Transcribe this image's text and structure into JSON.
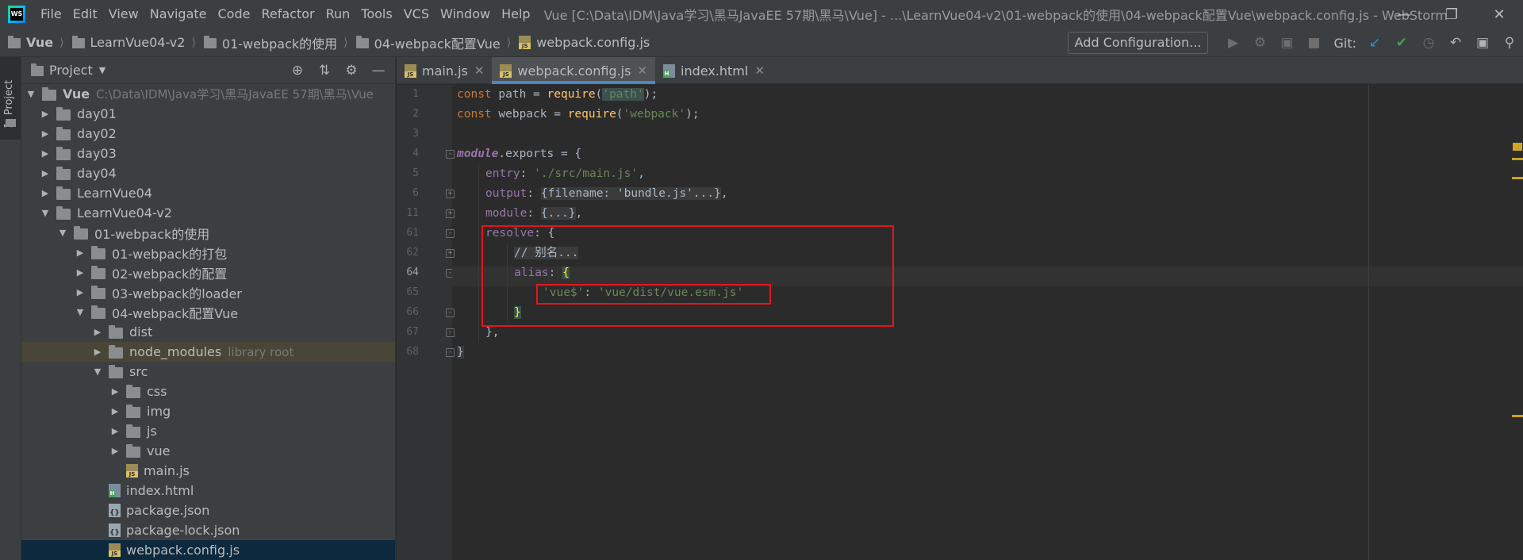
{
  "titlebar": {
    "menu": [
      "File",
      "Edit",
      "View",
      "Navigate",
      "Code",
      "Refactor",
      "Run",
      "Tools",
      "VCS",
      "Window",
      "Help"
    ],
    "window_title": "Vue [C:\\Data\\IDM\\Java学习\\黑马JavaEE 57期\\黑马\\Vue] - ...\\LearnVue04-v2\\01-webpack的使用\\04-webpack配置Vue\\webpack.config.js - WebStorm"
  },
  "navbar": {
    "crumbs": [
      "Vue",
      "LearnVue04-v2",
      "01-webpack的使用",
      "04-webpack配置Vue",
      "webpack.config.js"
    ],
    "add_config": "Add Configuration...",
    "git_label": "Git:"
  },
  "tool_strip": {
    "label": "1: Project"
  },
  "project_panel": {
    "title": "Project",
    "tree": [
      {
        "name": "Vue",
        "path": "C:\\Data\\IDM\\Java学习\\黑马JavaEE 57期\\黑马\\Vue"
      },
      {
        "name": "day01"
      },
      {
        "name": "day02"
      },
      {
        "name": "day03"
      },
      {
        "name": "day04"
      },
      {
        "name": "LearnVue04"
      },
      {
        "name": "LearnVue04-v2"
      },
      {
        "name": "01-webpack的使用"
      },
      {
        "name": "01-webpack的打包"
      },
      {
        "name": "02-webpack的配置"
      },
      {
        "name": "03-webpack的loader"
      },
      {
        "name": "04-webpack配置Vue"
      },
      {
        "name": "dist"
      },
      {
        "name": "node_modules",
        "note": "library root"
      },
      {
        "name": "src"
      },
      {
        "name": "css"
      },
      {
        "name": "img"
      },
      {
        "name": "js"
      },
      {
        "name": "vue"
      },
      {
        "name": "main.js"
      },
      {
        "name": "index.html"
      },
      {
        "name": "package.json"
      },
      {
        "name": "package-lock.json"
      },
      {
        "name": "webpack.config.js"
      }
    ]
  },
  "editor": {
    "tabs": [
      {
        "label": "main.js"
      },
      {
        "label": "webpack.config.js"
      },
      {
        "label": "index.html"
      }
    ],
    "line_numbers": [
      "1",
      "2",
      "3",
      "4",
      "5",
      "6",
      "11",
      "61",
      "62",
      "64",
      "65",
      "66",
      "67",
      "68"
    ],
    "code": {
      "l1": {
        "kw": "const",
        "a": " path = ",
        "fn": "require",
        "b": "(",
        "s": "'path'",
        "c": ");"
      },
      "l2": {
        "kw": "const",
        "a": " webpack = ",
        "fn": "require",
        "b": "(",
        "s": "'webpack'",
        "c": ");"
      },
      "l4": {
        "obj": "module",
        "a": ".exports = {"
      },
      "l5": {
        "p": "entry",
        "a": ": ",
        "s": "'./src/main.js'",
        "c": ","
      },
      "l6": {
        "p": "output",
        "a": ": ",
        "f": "{filename: 'bundle.js'...}",
        "c": ","
      },
      "l11": {
        "p": "module",
        "a": ": ",
        "f": "{...}",
        "c": ","
      },
      "l61": {
        "p": "resolve",
        "a": ": {"
      },
      "l62": {
        "cmt": "// 别名..."
      },
      "l64": {
        "p": "alias",
        "a": ": ",
        "brace": "{"
      },
      "l65": {
        "k": "'vue$'",
        "a": ": ",
        "s": "'vue/dist/vue.esm.js'"
      },
      "l66": {
        "brace": "}"
      },
      "l67": {
        "a": "},"
      },
      "l68": {
        "brace": "}"
      }
    }
  },
  "colors": {
    "background": "#2b2b2b",
    "panel": "#3c3f41",
    "keyword": "#cc7832",
    "string": "#6a8759",
    "property": "#9876aa",
    "function": "#ffc66d",
    "annotation_box": "#e8131a"
  }
}
